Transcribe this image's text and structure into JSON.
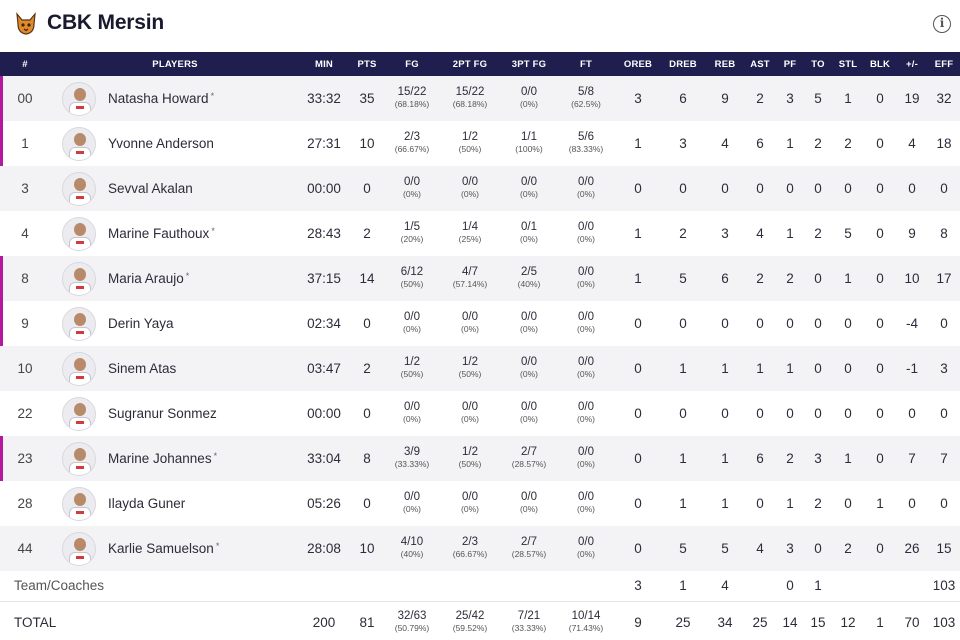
{
  "team": {
    "name": "CBK Mersin",
    "logo_icon": "lynx-logo-icon"
  },
  "info_icon": "info-icon",
  "accent_color": "#b5179e",
  "header_color": "#1f1e4f",
  "columns": [
    "#",
    "PLAYERS",
    "MIN",
    "PTS",
    "FG",
    "2PT FG",
    "3PT FG",
    "FT",
    "OREB",
    "DREB",
    "REB",
    "AST",
    "PF",
    "TO",
    "STL",
    "BLK",
    "+/-",
    "EFF"
  ],
  "players": [
    {
      "num": "00",
      "name": "Natasha Howard",
      "star": "*",
      "min": "33:32",
      "pts": "35",
      "fg": "15/22",
      "fg_p": "(68.18%)",
      "fg2": "15/22",
      "fg2_p": "(68.18%)",
      "fg3": "0/0",
      "fg3_p": "(0%)",
      "ft": "5/8",
      "ft_p": "(62.5%)",
      "oreb": "3",
      "dreb": "6",
      "reb": "9",
      "ast": "2",
      "pf": "3",
      "to": "5",
      "stl": "1",
      "blk": "0",
      "pm": "19",
      "eff": "32",
      "bar": true
    },
    {
      "num": "1",
      "name": "Yvonne Anderson",
      "star": "",
      "min": "27:31",
      "pts": "10",
      "fg": "2/3",
      "fg_p": "(66.67%)",
      "fg2": "1/2",
      "fg2_p": "(50%)",
      "fg3": "1/1",
      "fg3_p": "(100%)",
      "ft": "5/6",
      "ft_p": "(83.33%)",
      "oreb": "1",
      "dreb": "3",
      "reb": "4",
      "ast": "6",
      "pf": "1",
      "to": "2",
      "stl": "2",
      "blk": "0",
      "pm": "4",
      "eff": "18",
      "bar": true
    },
    {
      "num": "3",
      "name": "Sevval Akalan",
      "star": "",
      "min": "00:00",
      "pts": "0",
      "fg": "0/0",
      "fg_p": "(0%)",
      "fg2": "0/0",
      "fg2_p": "(0%)",
      "fg3": "0/0",
      "fg3_p": "(0%)",
      "ft": "0/0",
      "ft_p": "(0%)",
      "oreb": "0",
      "dreb": "0",
      "reb": "0",
      "ast": "0",
      "pf": "0",
      "to": "0",
      "stl": "0",
      "blk": "0",
      "pm": "0",
      "eff": "0",
      "bar": false
    },
    {
      "num": "4",
      "name": "Marine Fauthoux",
      "star": "*",
      "min": "28:43",
      "pts": "2",
      "fg": "1/5",
      "fg_p": "(20%)",
      "fg2": "1/4",
      "fg2_p": "(25%)",
      "fg3": "0/1",
      "fg3_p": "(0%)",
      "ft": "0/0",
      "ft_p": "(0%)",
      "oreb": "1",
      "dreb": "2",
      "reb": "3",
      "ast": "4",
      "pf": "1",
      "to": "2",
      "stl": "5",
      "blk": "0",
      "pm": "9",
      "eff": "8",
      "bar": false
    },
    {
      "num": "8",
      "name": "Maria Araujo",
      "star": "*",
      "min": "37:15",
      "pts": "14",
      "fg": "6/12",
      "fg_p": "(50%)",
      "fg2": "4/7",
      "fg2_p": "(57.14%)",
      "fg3": "2/5",
      "fg3_p": "(40%)",
      "ft": "0/0",
      "ft_p": "(0%)",
      "oreb": "1",
      "dreb": "5",
      "reb": "6",
      "ast": "2",
      "pf": "2",
      "to": "0",
      "stl": "1",
      "blk": "0",
      "pm": "10",
      "eff": "17",
      "bar": true
    },
    {
      "num": "9",
      "name": "Derin Yaya",
      "star": "",
      "min": "02:34",
      "pts": "0",
      "fg": "0/0",
      "fg_p": "(0%)",
      "fg2": "0/0",
      "fg2_p": "(0%)",
      "fg3": "0/0",
      "fg3_p": "(0%)",
      "ft": "0/0",
      "ft_p": "(0%)",
      "oreb": "0",
      "dreb": "0",
      "reb": "0",
      "ast": "0",
      "pf": "0",
      "to": "0",
      "stl": "0",
      "blk": "0",
      "pm": "-4",
      "eff": "0",
      "bar": true
    },
    {
      "num": "10",
      "name": "Sinem Atas",
      "star": "",
      "min": "03:47",
      "pts": "2",
      "fg": "1/2",
      "fg_p": "(50%)",
      "fg2": "1/2",
      "fg2_p": "(50%)",
      "fg3": "0/0",
      "fg3_p": "(0%)",
      "ft": "0/0",
      "ft_p": "(0%)",
      "oreb": "0",
      "dreb": "1",
      "reb": "1",
      "ast": "1",
      "pf": "1",
      "to": "0",
      "stl": "0",
      "blk": "0",
      "pm": "-1",
      "eff": "3",
      "bar": false
    },
    {
      "num": "22",
      "name": "Sugranur Sonmez",
      "star": "",
      "min": "00:00",
      "pts": "0",
      "fg": "0/0",
      "fg_p": "(0%)",
      "fg2": "0/0",
      "fg2_p": "(0%)",
      "fg3": "0/0",
      "fg3_p": "(0%)",
      "ft": "0/0",
      "ft_p": "(0%)",
      "oreb": "0",
      "dreb": "0",
      "reb": "0",
      "ast": "0",
      "pf": "0",
      "to": "0",
      "stl": "0",
      "blk": "0",
      "pm": "0",
      "eff": "0",
      "bar": false
    },
    {
      "num": "23",
      "name": "Marine Johannes",
      "star": "*",
      "min": "33:04",
      "pts": "8",
      "fg": "3/9",
      "fg_p": "(33.33%)",
      "fg2": "1/2",
      "fg2_p": "(50%)",
      "fg3": "2/7",
      "fg3_p": "(28.57%)",
      "ft": "0/0",
      "ft_p": "(0%)",
      "oreb": "0",
      "dreb": "1",
      "reb": "1",
      "ast": "6",
      "pf": "2",
      "to": "3",
      "stl": "1",
      "blk": "0",
      "pm": "7",
      "eff": "7",
      "bar": true
    },
    {
      "num": "28",
      "name": "Ilayda Guner",
      "star": "",
      "min": "05:26",
      "pts": "0",
      "fg": "0/0",
      "fg_p": "(0%)",
      "fg2": "0/0",
      "fg2_p": "(0%)",
      "fg3": "0/0",
      "fg3_p": "(0%)",
      "ft": "0/0",
      "ft_p": "(0%)",
      "oreb": "0",
      "dreb": "1",
      "reb": "1",
      "ast": "0",
      "pf": "1",
      "to": "2",
      "stl": "0",
      "blk": "1",
      "pm": "0",
      "eff": "0",
      "bar": false
    },
    {
      "num": "44",
      "name": "Karlie Samuelson",
      "star": "*",
      "min": "28:08",
      "pts": "10",
      "fg": "4/10",
      "fg_p": "(40%)",
      "fg2": "2/3",
      "fg2_p": "(66.67%)",
      "fg3": "2/7",
      "fg3_p": "(28.57%)",
      "ft": "0/0",
      "ft_p": "(0%)",
      "oreb": "0",
      "dreb": "5",
      "reb": "5",
      "ast": "4",
      "pf": "3",
      "to": "0",
      "stl": "2",
      "blk": "0",
      "pm": "26",
      "eff": "15",
      "bar": false
    }
  ],
  "team_row": {
    "label": "Team/Coaches",
    "oreb": "3",
    "dreb": "1",
    "reb": "4",
    "ast": "",
    "pf": "0",
    "to": "1",
    "stl": "",
    "blk": "",
    "pm": "",
    "eff": "103"
  },
  "total_row": {
    "label": "TOTAL",
    "min": "200",
    "pts": "81",
    "fg": "32/63",
    "fg_p": "(50.79%)",
    "fg2": "25/42",
    "fg2_p": "(59.52%)",
    "fg3": "7/21",
    "fg3_p": "(33.33%)",
    "ft": "10/14",
    "ft_p": "(71.43%)",
    "oreb": "9",
    "dreb": "25",
    "reb": "34",
    "ast": "25",
    "pf": "14",
    "to": "15",
    "stl": "12",
    "blk": "1",
    "pm": "70",
    "eff": "103"
  }
}
